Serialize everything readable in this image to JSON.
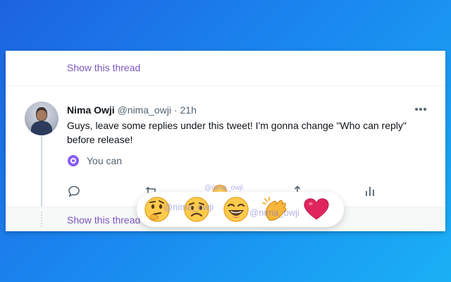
{
  "thread": {
    "show_thread_top": "Show this thread",
    "show_thread_bottom": "Show this thread"
  },
  "tweet": {
    "author_name": "Nima Owji",
    "author_handle": "@nima_owji",
    "separator": "·",
    "time": "21h",
    "text": "Guys, leave some replies under this tweet! I'm gonna change \"Who can reply\" before release!",
    "reply_restriction_note": "You can"
  },
  "reactions": {
    "items": [
      "thinking-face",
      "sad-face",
      "laughing-face",
      "clapping-hands",
      "red-heart"
    ]
  },
  "watermarks": {
    "mark_1": "@nima_owji",
    "mark_2": "@nima_owji",
    "mark_3": "@nima_owji"
  },
  "icons": {
    "reply": "reply-icon",
    "retweet": "retweet-icon",
    "share": "share-icon",
    "analytics": "analytics-icon",
    "more": "more-icon"
  },
  "colors": {
    "link_purple": "#7b55c2",
    "text_primary": "#0f1419",
    "text_secondary": "#536471",
    "badge_purple": "#8a5cf5",
    "heart_red": "#e0245e"
  }
}
